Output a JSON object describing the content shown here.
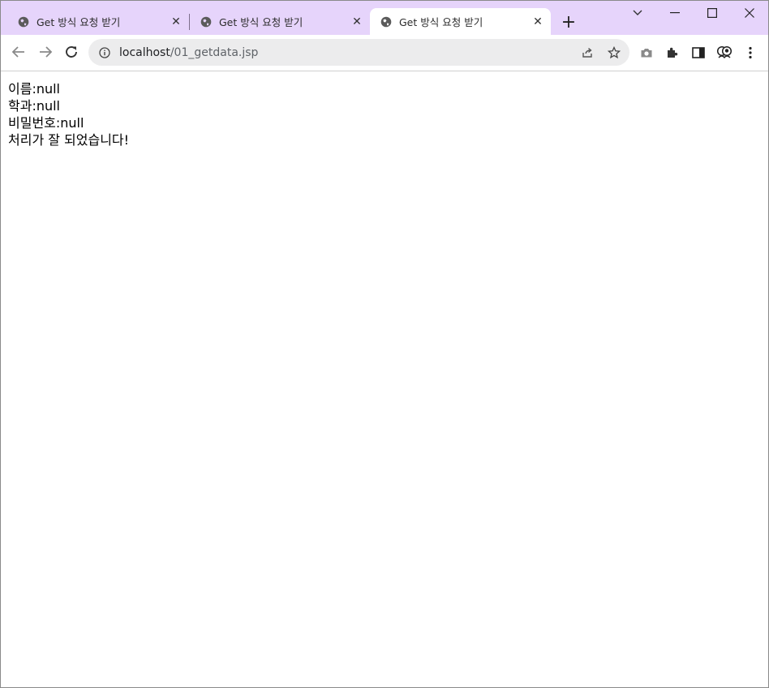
{
  "tabs": [
    {
      "title": "Get 방식 요청 받기",
      "close": "✕",
      "active": false
    },
    {
      "title": "Get 방식 요청 받기",
      "close": "✕",
      "active": false
    },
    {
      "title": "Get 방식 요청 받기",
      "close": "✕",
      "active": true
    }
  ],
  "new_tab_label": "+",
  "window_controls": {
    "tab_search": "⌄",
    "minimize": "—",
    "maximize": "☐",
    "close": "✕"
  },
  "address": {
    "host": "localhost",
    "path": "/01_getdata.jsp"
  },
  "page": {
    "lines": [
      "이름:null",
      "학과:null",
      "비밀번호:null",
      "처리가 잘 되었습니다!"
    ]
  },
  "colors": {
    "tabstrip": "#e6d4fb",
    "active_tab": "#ffffff",
    "omnibox": "#ececed"
  }
}
